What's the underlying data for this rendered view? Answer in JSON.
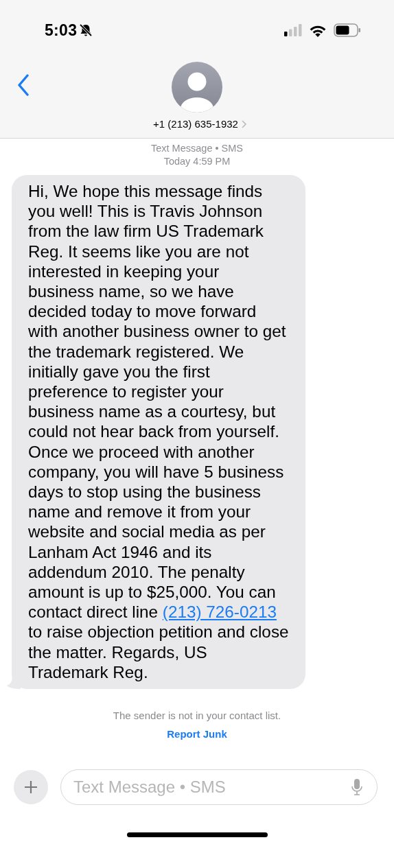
{
  "status_bar": {
    "time": "5:03",
    "silent": true
  },
  "header": {
    "contact": "+1 (213) 635-1932"
  },
  "conversation": {
    "service": "Text Message • SMS",
    "timestamp": "Today 4:59 PM",
    "messages": [
      {
        "parts": [
          {
            "kind": "text",
            "text": "Hi, We hope this message finds you well! This is Travis Johnson from the law firm US Trademark Reg. It seems like you are not interested in keeping your business name, so we have decided today to move forward with another business owner to get the trademark registered. We initially gave you the first preference to register your business name as a courtesy, but could not hear back from yourself. Once we proceed with another company, you will have 5 business days to stop using the business name and remove it from your website and social media as per Lanham Act 1946 and its addendum 2010. The penalty amount is up to $25,000. You can contact direct line "
          },
          {
            "kind": "link",
            "text": "(213) 726-0213"
          },
          {
            "kind": "text",
            "text": " to raise objection petition and close the matter. Regards, US Trademark Reg."
          }
        ]
      }
    ],
    "notice": "The sender is not in your contact list.",
    "report_link": "Report Junk"
  },
  "composer": {
    "placeholder": "Text Message • SMS"
  }
}
